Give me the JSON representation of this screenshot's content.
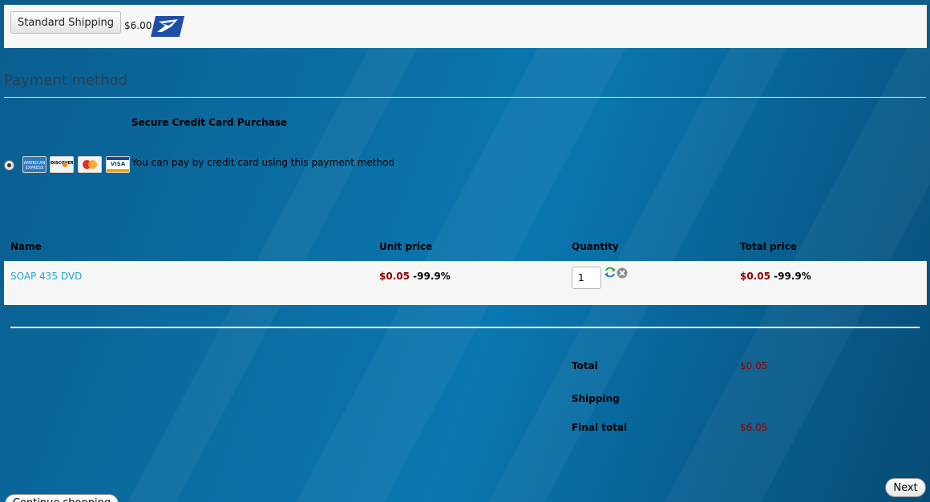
{
  "shipping": {
    "button_label": "Standard Shipping",
    "price": "$6.00",
    "carrier_icon": "usps-eagle-icon"
  },
  "payment": {
    "section_title": "Payment method",
    "method_title": "Secure Credit Card Purchase",
    "description": "You can pay by credit card using this payment method",
    "cards": [
      {
        "name": "amex-card-icon",
        "label": "AMERICAN EXPRESS",
        "color": "#2b7bc4"
      },
      {
        "name": "discover-card-icon",
        "label": "DISCOVER",
        "color": "#f3f3f3"
      },
      {
        "name": "mastercard-card-icon",
        "label": "MasterCard",
        "color": "#f4f4f4"
      },
      {
        "name": "visa-card-icon",
        "label": "VISA",
        "color": "#1a4a9c"
      }
    ]
  },
  "cart": {
    "headers": {
      "name": "Name",
      "unit_price": "Unit price",
      "quantity": "Quantity",
      "total_price": "Total price"
    },
    "items": [
      {
        "name": "SOAP 435 DVD",
        "unit_price": "$0.05",
        "unit_discount": "-99.9%",
        "quantity": "1",
        "total_price": "$0.05",
        "total_discount": "-99.9%"
      }
    ]
  },
  "summary": {
    "total_label": "Total",
    "total_value": "$0.05",
    "shipping_label": "Shipping",
    "shipping_value": "",
    "final_label": "Final total",
    "final_value": "$6.05"
  },
  "actions": {
    "next_label": "Next",
    "continue_label": "Continue shopping"
  },
  "colors": {
    "background": "#0a6ea3",
    "price": "#8b0000",
    "link": "#1ea7d8"
  }
}
